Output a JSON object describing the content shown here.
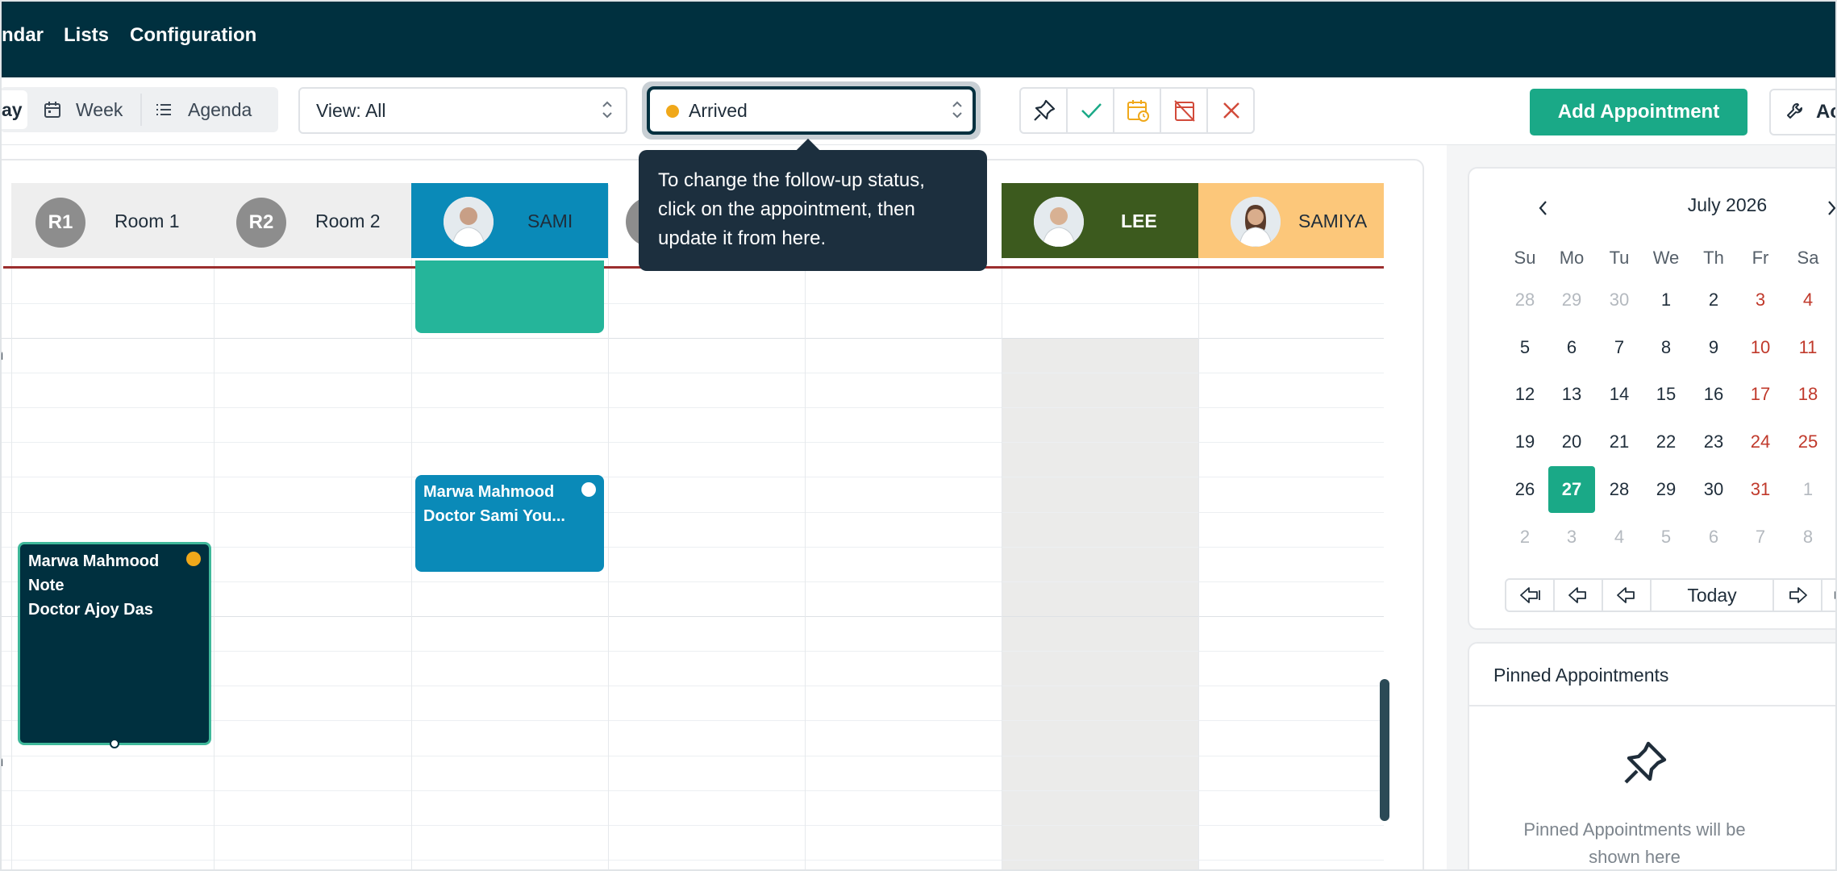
{
  "nav": {
    "items": [
      "ndar",
      "Lists",
      "Configuration"
    ]
  },
  "toolbar": {
    "day_label": "ay",
    "week_label": "Week",
    "agenda_label": "Agenda",
    "view_select": "View: All",
    "status_select": "Arrived",
    "add_appointment": "Add Appointment",
    "tools_label": "Ac"
  },
  "tooltip": {
    "text": "To change the follow-up status, click on the appointment, then update it from here."
  },
  "resources": [
    {
      "badge": "R1",
      "name": "Room 1",
      "color": "#eeeeee"
    },
    {
      "badge": "R2",
      "name": "Room 2",
      "color": "#eeeeee"
    },
    {
      "name": "SAMI",
      "color": "#0a8ab8"
    },
    {
      "name": "LEE",
      "color": "#3c5a1e"
    },
    {
      "name": "SAMIYA",
      "color": "#fcc77a"
    }
  ],
  "time_labels": [
    "n",
    "n"
  ],
  "appointments": [
    {
      "lines": [
        "Marwa Mahmood",
        "Doctor Sami You..."
      ],
      "color": "#0a8ab8",
      "status_color": "#ffffff"
    },
    {
      "lines": [
        "Marwa Mahmood",
        "Note",
        "Doctor Ajoy Das"
      ],
      "color": "#00303f",
      "status_color": "#f0a81a"
    }
  ],
  "mini_calendar": {
    "month_label": "July 2026",
    "weekdays": [
      "Su",
      "Mo",
      "Tu",
      "We",
      "Th",
      "Fr",
      "Sa"
    ],
    "weeks": [
      [
        "28",
        "29",
        "30",
        "1",
        "2",
        "3",
        "4"
      ],
      [
        "5",
        "6",
        "7",
        "8",
        "9",
        "10",
        "11"
      ],
      [
        "12",
        "13",
        "14",
        "15",
        "16",
        "17",
        "18"
      ],
      [
        "19",
        "20",
        "21",
        "22",
        "23",
        "24",
        "25"
      ],
      [
        "26",
        "27",
        "28",
        "29",
        "30",
        "31",
        "1"
      ],
      [
        "2",
        "3",
        "4",
        "5",
        "6",
        "7",
        "8"
      ]
    ],
    "selected": "27",
    "today_label": "Today"
  },
  "pinned": {
    "title": "Pinned Appointments",
    "empty_text": "Pinned Appointments will be shown here"
  },
  "colors": {
    "brand": "#00303f",
    "accent": "#1aa987",
    "arrived": "#f0a81a",
    "weekend": "#c0392b"
  }
}
